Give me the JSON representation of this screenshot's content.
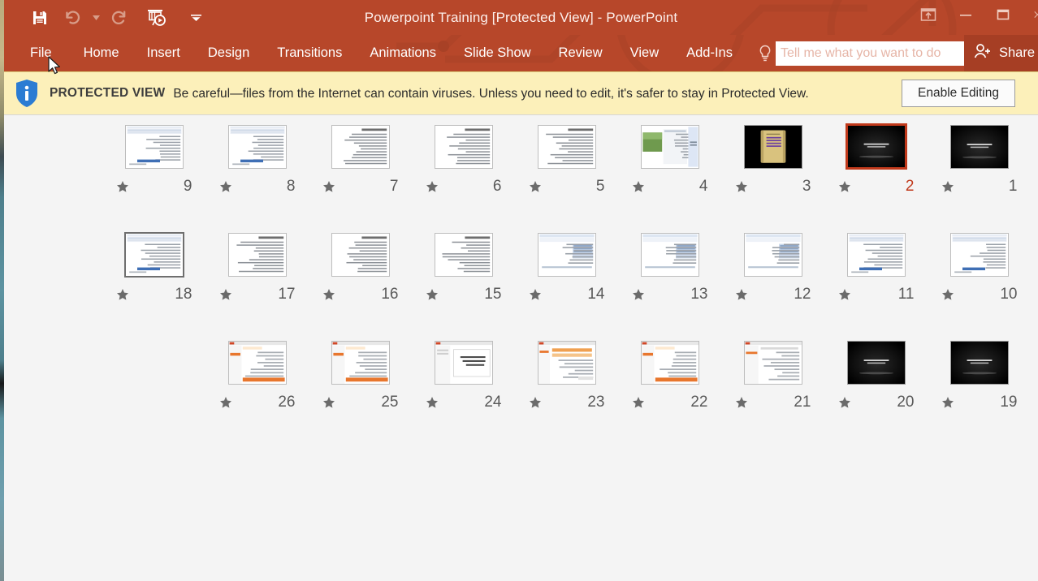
{
  "window": {
    "title": "Powerpoint Training [Protected View] - PowerPoint",
    "accent_color": "#b7472a",
    "share_button_color": "#a63e24",
    "quick_access": [
      {
        "name": "save-icon",
        "label": "Save",
        "state": "enabled"
      },
      {
        "name": "undo-icon",
        "label": "Undo",
        "state": "disabled"
      },
      {
        "name": "undo-dropdown-icon",
        "label": "Undo options",
        "state": "disabled"
      },
      {
        "name": "redo-icon",
        "label": "Redo",
        "state": "disabled"
      },
      {
        "name": "start-presentation-icon",
        "label": "Start From Beginning",
        "state": "enabled"
      },
      {
        "name": "customize-quick-access-icon",
        "label": "Customize Quick Access Toolbar",
        "state": "enabled"
      }
    ],
    "controls": [
      {
        "name": "ribbon-display-options-icon",
        "label": "Ribbon Display Options"
      },
      {
        "name": "minimize-icon",
        "label": "Minimize"
      },
      {
        "name": "restore-icon",
        "label": "Restore Down"
      },
      {
        "name": "close-icon",
        "label": "Close"
      }
    ]
  },
  "ribbon": {
    "tabs": [
      {
        "label": "File",
        "active": false
      },
      {
        "label": "Home",
        "active": false
      },
      {
        "label": "Insert",
        "active": false
      },
      {
        "label": "Design",
        "active": false
      },
      {
        "label": "Transitions",
        "active": false
      },
      {
        "label": "Animations",
        "active": false
      },
      {
        "label": "Slide Show",
        "active": false
      },
      {
        "label": "Review",
        "active": false
      },
      {
        "label": "View",
        "active": false
      },
      {
        "label": "Add-Ins",
        "active": false
      }
    ],
    "tell_me": {
      "placeholder": "Tell me what you want to do",
      "value": "",
      "icon": "lightbulb-icon"
    },
    "share": {
      "label": "Share",
      "icon": "share-person-icon"
    }
  },
  "protected_view": {
    "icon": "info-shield-icon",
    "label": "PROTECTED VIEW",
    "message": "Be careful—files from the Internet can contain viruses. Unless you need to edit, it's safer to stay in Protected View.",
    "button_label": "Enable Editing",
    "background": "#fcf0ba"
  },
  "slide_sorter": {
    "selected_slide": 2,
    "hovered_slide": 18,
    "star_icon": "star-icon",
    "rows": [
      {
        "slides": [
          {
            "number": "9",
            "kind": "doc-screenshot"
          },
          {
            "number": "8",
            "kind": "doc-screenshot"
          },
          {
            "number": "7",
            "kind": "text-page"
          },
          {
            "number": "6",
            "kind": "text-page"
          },
          {
            "number": "5",
            "kind": "text-page"
          },
          {
            "number": "4",
            "kind": "photo-panel"
          },
          {
            "number": "3",
            "kind": "dark-scroll"
          },
          {
            "number": "2",
            "kind": "dark-title"
          },
          {
            "number": "1",
            "kind": "dark-title"
          }
        ]
      },
      {
        "slides": [
          {
            "number": "18",
            "kind": "doc-screenshot"
          },
          {
            "number": "17",
            "kind": "text-page"
          },
          {
            "number": "16",
            "kind": "text-page"
          },
          {
            "number": "15",
            "kind": "text-page"
          },
          {
            "number": "14",
            "kind": "app-screenshot"
          },
          {
            "number": "13",
            "kind": "app-screenshot"
          },
          {
            "number": "12",
            "kind": "app-screenshot"
          },
          {
            "number": "11",
            "kind": "doc-screenshot"
          },
          {
            "number": "10",
            "kind": "doc-screenshot"
          }
        ]
      },
      {
        "slides": [
          {
            "number": "26",
            "kind": "ppt-backstage"
          },
          {
            "number": "25",
            "kind": "ppt-backstage"
          },
          {
            "number": "24",
            "kind": "ppt-print"
          },
          {
            "number": "23",
            "kind": "ppt-grid"
          },
          {
            "number": "22",
            "kind": "ppt-backstage"
          },
          {
            "number": "21",
            "kind": "ppt-pane"
          },
          {
            "number": "20",
            "kind": "dark-title"
          },
          {
            "number": "19",
            "kind": "dark-title"
          }
        ]
      }
    ]
  }
}
